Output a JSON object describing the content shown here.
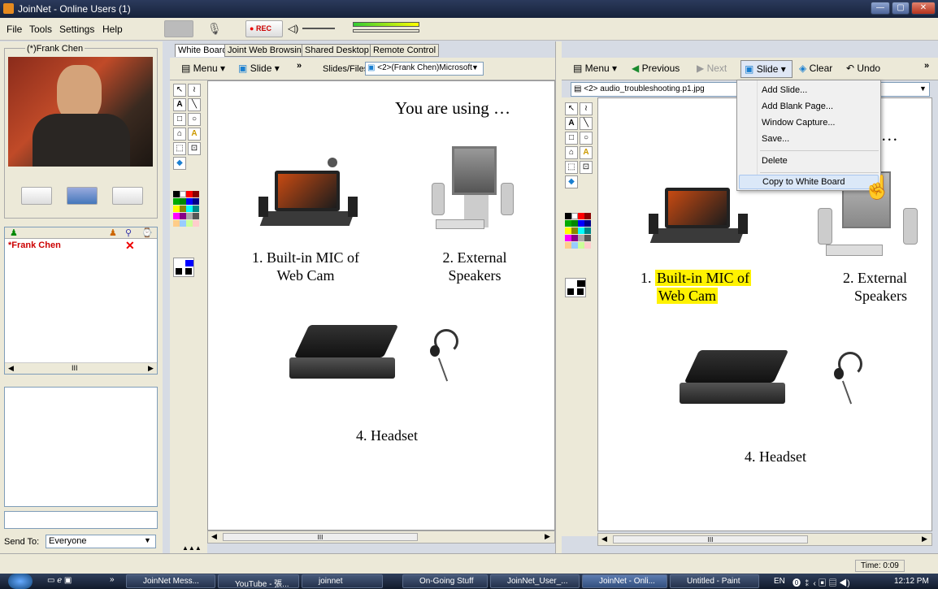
{
  "window": {
    "title": "JoinNet - Online Users (1)",
    "controls": [
      "—",
      "▢",
      "✕"
    ]
  },
  "menu": {
    "items": [
      "File",
      "Tools",
      "Settings",
      "Help"
    ],
    "rec_label": "REC"
  },
  "left_panel": {
    "video_name": "(*)Frank Chen",
    "users_columns": [
      "♟",
      "♟",
      "⚲",
      "⌚"
    ],
    "users": [
      {
        "name": "*Frank Chen",
        "status": "✕"
      }
    ],
    "scroll_h": "III",
    "send_to_label": "Send To:",
    "send_to_value": "Everyone"
  },
  "tabs": [
    "White Board",
    "Joint Web Browsing",
    "Shared Desktop",
    "Remote Control"
  ],
  "left_toolbar": {
    "menu": "Menu",
    "slide": "Slide",
    "more": "»",
    "slides_files": "Slides/Files",
    "slide_select": "<2>(Frank Chen)Microsoft"
  },
  "right_toolbar": {
    "menu": "Menu",
    "previous": "Previous",
    "next": "Next",
    "slide": "Slide",
    "clear": "Clear",
    "undo": "Undo",
    "more": "»",
    "file": "<2> audio_troubleshooting.p1.jpg"
  },
  "slide_left": {
    "heading": "You are using …",
    "item1": "1. Built-in MIC of Web Cam",
    "item2": "2. External Speakers",
    "item4": "4. Headset",
    "scroll_label": "III"
  },
  "slide_right": {
    "heading_tail": "g …",
    "item1_prefix": "1. ",
    "item1_line1": "Built-in MIC of",
    "item1_line2": "Web Cam",
    "item2": "2. External Speakers",
    "item4": "4. Headset",
    "scroll_label": "III"
  },
  "dropdown": {
    "items": [
      "Add Slide...",
      "Add Blank Page...",
      "Window Capture...",
      "Save...",
      "Delete",
      "Copy to White Board"
    ],
    "highlighted": "Copy to White Board"
  },
  "status": {
    "time": "Time: 0:09"
  },
  "taskbar": {
    "more": "»",
    "items": [
      "JoinNet Mess...",
      "YouTube - 張...",
      "joinnet",
      "On-Going Stuff",
      "JoinNet_User_...",
      "JoinNet - Onli...",
      "Untitled - Paint"
    ],
    "lang": "EN",
    "clock": "12:12 PM"
  },
  "colors": {
    "accent": "#1f5fbf",
    "user_red": "#cc0000",
    "highlight": "#fff200"
  }
}
